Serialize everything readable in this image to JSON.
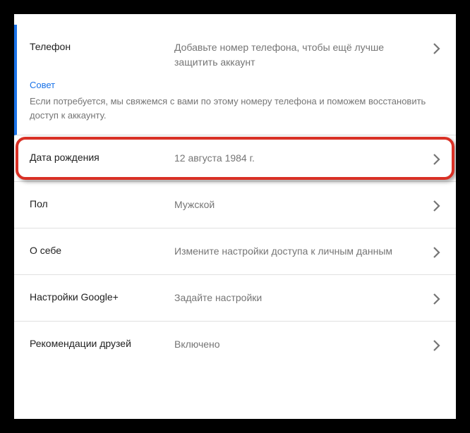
{
  "rows": {
    "phone": {
      "label": "Телефон",
      "value": "Добавьте номер телефона, чтобы ещё лучше защитить аккаунт",
      "tip_label": "Совет",
      "tip_text": "Если потребуется, мы свяжемся с вами по этому номеру телефона и поможем восстановить доступ к аккаунту."
    },
    "birthday": {
      "label": "Дата рождения",
      "value": "12 августа 1984 г."
    },
    "gender": {
      "label": "Пол",
      "value": "Мужской"
    },
    "about": {
      "label": "О себе",
      "value": "Измените настройки доступа к личным данным"
    },
    "gplus": {
      "label": "Настройки Google+",
      "value": "Задайте настройки"
    },
    "recommendations": {
      "label": "Рекомендации друзей",
      "value": "Включено"
    }
  },
  "colors": {
    "accent": "#1a73e8",
    "highlight": "#d93025",
    "text_primary": "#212121",
    "text_secondary": "#757575"
  }
}
